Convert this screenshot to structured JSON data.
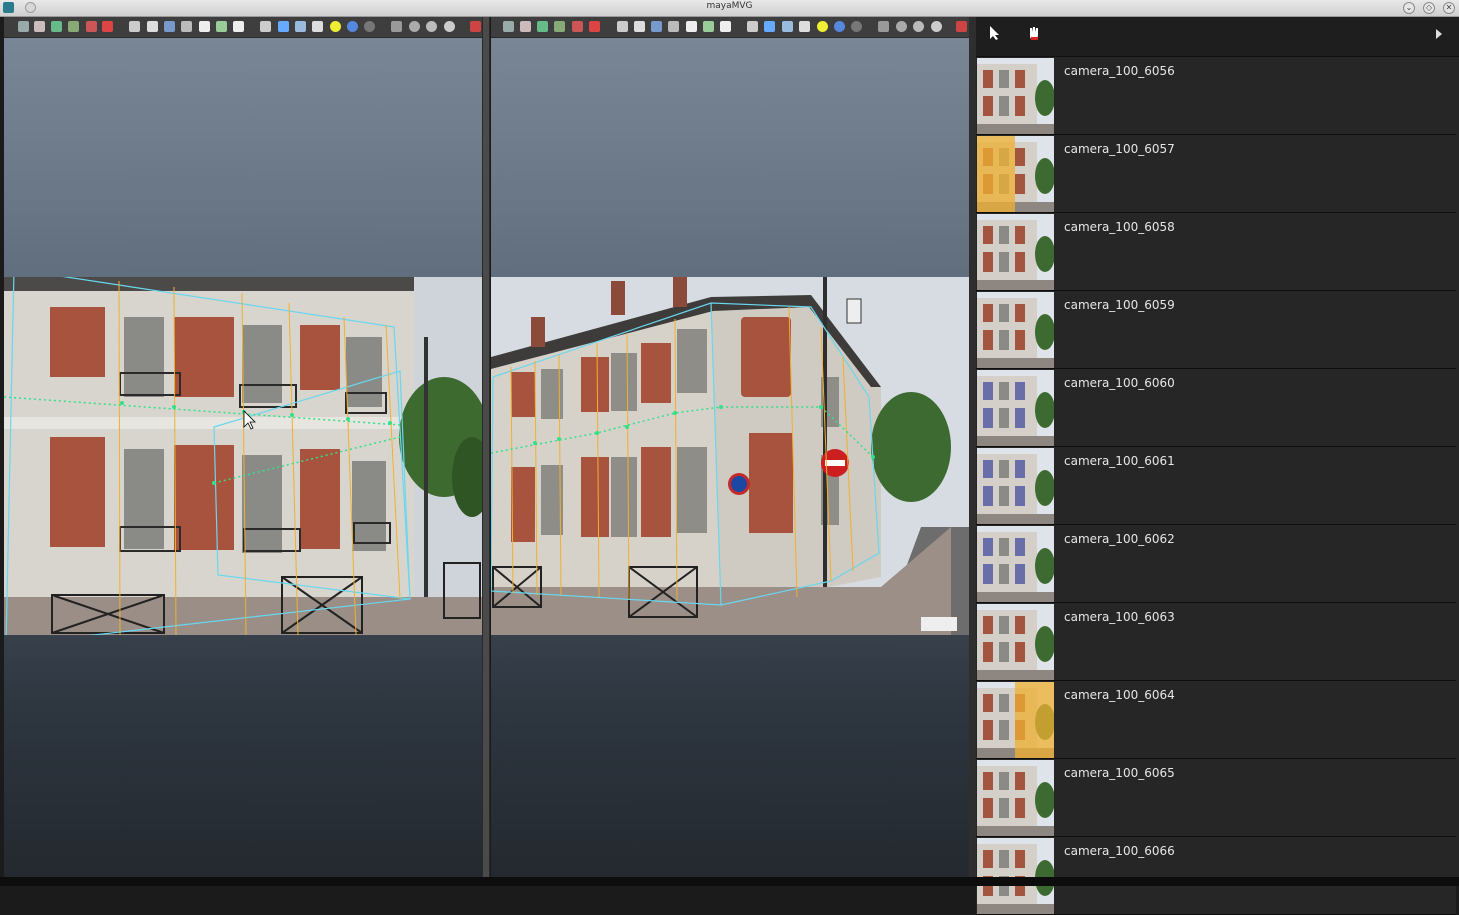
{
  "window": {
    "title": "mayaMVG"
  },
  "cameras": [
    {
      "label": "camera_100_6056",
      "selected": false
    },
    {
      "label": "camera_100_6057",
      "selected": true
    },
    {
      "label": "camera_100_6058",
      "selected": false
    },
    {
      "label": "camera_100_6059",
      "selected": false
    },
    {
      "label": "camera_100_6060",
      "selected": false
    },
    {
      "label": "camera_100_6061",
      "selected": false
    },
    {
      "label": "camera_100_6062",
      "selected": false
    },
    {
      "label": "camera_100_6063",
      "selected": false
    },
    {
      "label": "camera_100_6064",
      "selected": true
    },
    {
      "label": "camera_100_6065",
      "selected": false
    },
    {
      "label": "camera_100_6066",
      "selected": false
    }
  ],
  "sidebar_tools": {
    "select_icon": "arrow-cursor-icon",
    "place_icon": "hand-place-icon",
    "collapse_icon": "triangle-right-icon"
  },
  "colors": {
    "accent": "#f0b030",
    "point": "#33e08a",
    "wire": "#6ad7ee"
  }
}
